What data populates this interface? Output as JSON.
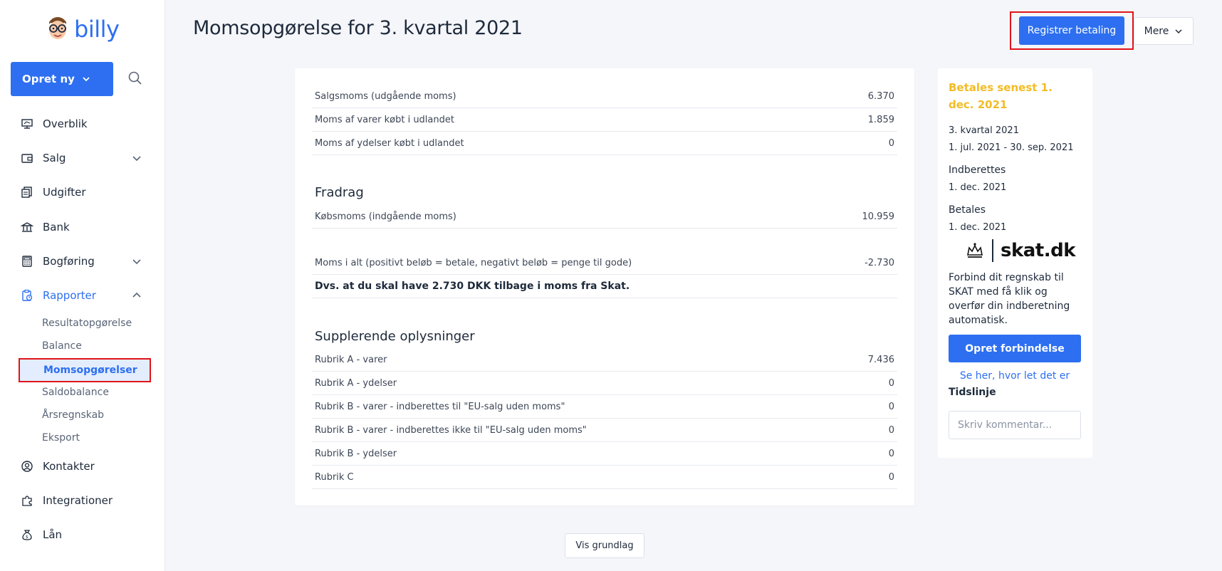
{
  "app": {
    "name": "billy"
  },
  "sidebar": {
    "create_label": "Opret ny",
    "items": [
      {
        "label": "Overblik"
      },
      {
        "label": "Salg"
      },
      {
        "label": "Udgifter"
      },
      {
        "label": "Bank"
      },
      {
        "label": "Bogføring"
      },
      {
        "label": "Rapporter"
      },
      {
        "label": "Kontakter"
      },
      {
        "label": "Integrationer"
      },
      {
        "label": "Lån"
      }
    ],
    "reports_sub": [
      {
        "label": "Resultatopgørelse"
      },
      {
        "label": "Balance"
      },
      {
        "label": "Momsopgørelser"
      },
      {
        "label": "Saldobalance"
      },
      {
        "label": "Årsregnskab"
      },
      {
        "label": "Eksport"
      }
    ]
  },
  "header": {
    "title": "Momsopgørelse for 3. kvartal 2021",
    "register_payment": "Registrer betaling",
    "more": "Mere"
  },
  "report": {
    "sales": [
      {
        "label": "Salgsmoms (udgående moms)",
        "value": "6.370"
      },
      {
        "label": "Moms af varer købt i udlandet",
        "value": "1.859"
      },
      {
        "label": "Moms af ydelser købt i udlandet",
        "value": "0"
      }
    ],
    "deductions_title": "Fradrag",
    "deductions": [
      {
        "label": "Købsmoms (indgående moms)",
        "value": "10.959"
      }
    ],
    "total": {
      "label": "Moms i alt (positivt beløb = betale, negativt beløb = penge til gode)",
      "value": "-2.730"
    },
    "summary": "Dvs. at du skal have 2.730 DKK tilbage i moms fra Skat.",
    "supplementary_title": "Supplerende oplysninger",
    "supplementary": [
      {
        "label": "Rubrik A - varer",
        "value": "7.436"
      },
      {
        "label": "Rubrik A - ydelser",
        "value": "0"
      },
      {
        "label": "Rubrik B - varer - indberettes til \"EU-salg uden moms\"",
        "value": "0"
      },
      {
        "label": "Rubrik B - varer - indberettes ikke til \"EU-salg uden moms\"",
        "value": "0"
      },
      {
        "label": "Rubrik B - ydelser",
        "value": "0"
      },
      {
        "label": "Rubrik C",
        "value": "0"
      }
    ],
    "show_basis": "Vis grundlag"
  },
  "side": {
    "due": "Betales senest 1. dec. 2021",
    "period_title": "3. kvartal 2021",
    "period_range": "1. jul. 2021 - 30. sep. 2021",
    "report_label": "Indberettes",
    "report_date": "1. dec. 2021",
    "pay_label": "Betales",
    "pay_date": "1. dec. 2021",
    "skat_logo_text": "skat.dk",
    "promo": "Forbind dit regnskab til SKAT med få klik og overfør din indberetning automatisk.",
    "connect": "Opret forbindelse",
    "link": "Se her, hvor let det er",
    "timeline": "Tidslinje",
    "comment_placeholder": "Skriv kommentar..."
  },
  "colors": {
    "primary": "#2d6ff0",
    "due": "#f2bc24",
    "highlight": "#e0141a"
  }
}
